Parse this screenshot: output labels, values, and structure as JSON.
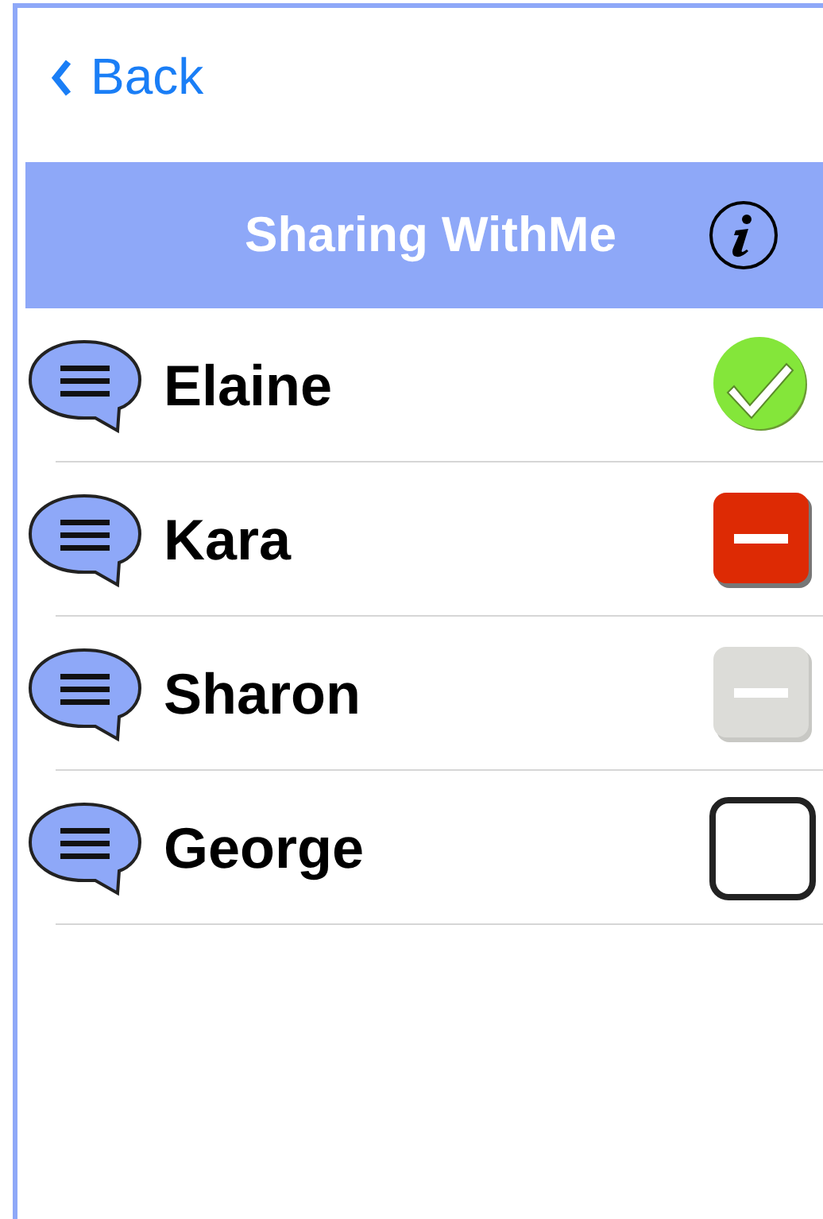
{
  "nav": {
    "back_label": "Back"
  },
  "header": {
    "title": "Sharing WithMe"
  },
  "contacts": [
    {
      "name": "Elaine",
      "kind": "accepted"
    },
    {
      "name": "Kara",
      "kind": "declined"
    },
    {
      "name": "Sharon",
      "kind": "pending"
    },
    {
      "name": "George",
      "kind": "unset"
    }
  ]
}
